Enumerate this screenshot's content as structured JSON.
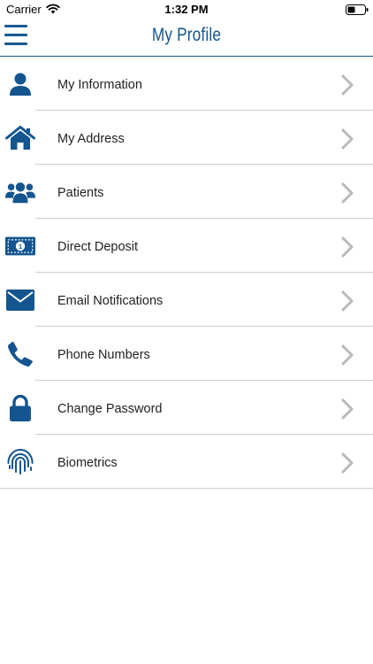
{
  "status_bar": {
    "carrier": "Carrier",
    "time": "1:32 PM"
  },
  "header": {
    "title": "My Profile"
  },
  "colors": {
    "brand": "#14558f",
    "divider": "#cfcfcf",
    "chevron": "#b9b9b9"
  },
  "menu": {
    "items": [
      {
        "label": "My Information",
        "icon": "user-icon"
      },
      {
        "label": "My Address",
        "icon": "home-icon"
      },
      {
        "label": "Patients",
        "icon": "group-icon"
      },
      {
        "label": "Direct Deposit",
        "icon": "money-icon"
      },
      {
        "label": "Email Notifications",
        "icon": "envelope-icon"
      },
      {
        "label": "Phone Numbers",
        "icon": "phone-icon"
      },
      {
        "label": "Change Password",
        "icon": "lock-icon"
      },
      {
        "label": "Biometrics",
        "icon": "fingerprint-icon"
      }
    ]
  }
}
